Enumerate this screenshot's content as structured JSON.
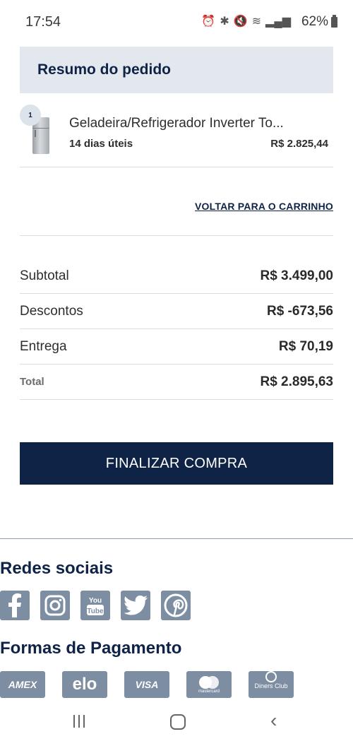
{
  "status_bar": {
    "time": "17:54",
    "battery": "62%",
    "icons": [
      "alarm-icon",
      "bluetooth-icon",
      "mute-icon",
      "wifi-icon",
      "signal-icon",
      "signal-icon"
    ]
  },
  "summary": {
    "title": "Resumo do pedido"
  },
  "product": {
    "quantity": "1",
    "name": "Geladeira/Refrigerador Inverter To...",
    "delivery": "14 dias úteis",
    "price": "R$ 2.825,44"
  },
  "back_to_cart": "VOLTAR PARA O CARRINHO",
  "totals": [
    {
      "label": "Subtotal",
      "value": "R$ 3.499,00"
    },
    {
      "label": "Descontos",
      "value": "R$ -673,56"
    },
    {
      "label": "Entrega",
      "value": "R$ 70,19"
    },
    {
      "label": "Total",
      "value": "R$ 2.895,63"
    }
  ],
  "checkout_label": "FINALIZAR COMPRA",
  "footer": {
    "social_title": "Redes sociais",
    "social_icons": [
      "facebook-icon",
      "instagram-icon",
      "youtube-icon",
      "twitter-icon",
      "pinterest-icon"
    ],
    "payment_title": "Formas de Pagamento",
    "payment_labels": [
      "AMEX",
      "elo",
      "VISA",
      "mastercard",
      "Diners Club"
    ]
  },
  "colors": {
    "primary": "#0f2347",
    "header_bg": "#e3e8ee",
    "icon_bg": "#7d8ea3"
  }
}
